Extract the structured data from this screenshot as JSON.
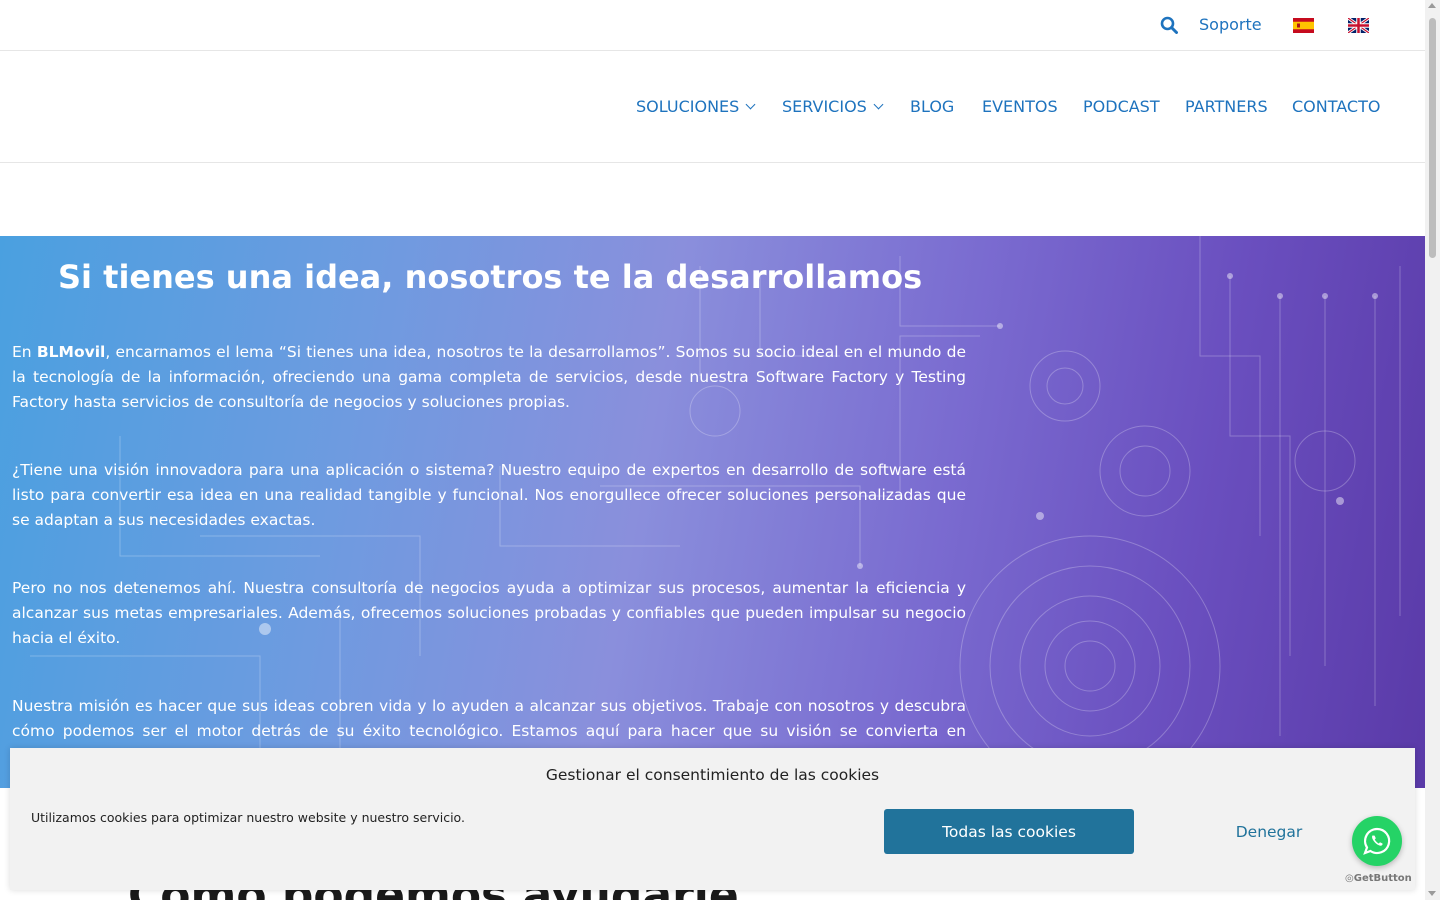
{
  "topbar": {
    "support_label": "Soporte",
    "search_icon": "search-icon",
    "flags": [
      "spain-flag-icon",
      "uk-flag-icon"
    ]
  },
  "nav": {
    "items": [
      {
        "label": "SOLUCIONES",
        "has_dropdown": true
      },
      {
        "label": "SERVICIOS",
        "has_dropdown": true
      },
      {
        "label": "BLOG",
        "has_dropdown": false
      },
      {
        "label": "EVENTOS",
        "has_dropdown": false
      },
      {
        "label": "PODCAST",
        "has_dropdown": false
      },
      {
        "label": "PARTNERS",
        "has_dropdown": false
      },
      {
        "label": "CONTACTO",
        "has_dropdown": false
      }
    ]
  },
  "hero": {
    "title": "Si tienes una idea, nosotros te la desarrollamos",
    "p1_prefix": "En ",
    "p1_brand": "BLMovil",
    "p1_rest": ", encarnamos el lema “Si tienes una idea, nosotros te la desarrollamos”. Somos su socio ideal en el mundo de la tecnología de la información, ofreciendo una gama completa de servicios, desde nuestra Software Factory y Testing Factory hasta servicios de consultoría de negocios y soluciones propias.",
    "p2": "¿Tiene una visión innovadora para una aplicación o sistema? Nuestro equipo de expertos en desarrollo de software está listo para convertir esa idea en una realidad tangible y funcional. Nos enorgullece ofrecer soluciones personalizadas que se adaptan a sus necesidades exactas.",
    "p3": "Pero no nos detenemos ahí. Nuestra consultoría de negocios ayuda a optimizar sus procesos, aumentar la eficiencia y alcanzar sus metas empresariales. Además, ofrecemos soluciones probadas y confiables que pueden impulsar su negocio hacia el éxito.",
    "p4": "Nuestra misión es hacer que sus ideas cobren vida y lo ayuden a alcanzar sus objetivos. Trabaje con nosotros y descubra cómo podemos ser el motor detrás de su éxito tecnológico. Estamos aquí para hacer que su visión se convierta en realidad."
  },
  "section": {
    "heading": "Cómo podemos ayudarle"
  },
  "cookie_banner": {
    "title": "Gestionar el consentimiento de las cookies",
    "message": "Utilizamos cookies para optimizar nuestro website y nuestro servicio.",
    "accept_label": "Todas las cookies",
    "deny_label": "Denegar"
  },
  "whatsapp": {
    "icon": "whatsapp-icon",
    "credit": "GetButton"
  },
  "colors": {
    "link_blue": "#1e73be",
    "button_blue": "#21739b",
    "whatsapp_green": "#25d366"
  }
}
